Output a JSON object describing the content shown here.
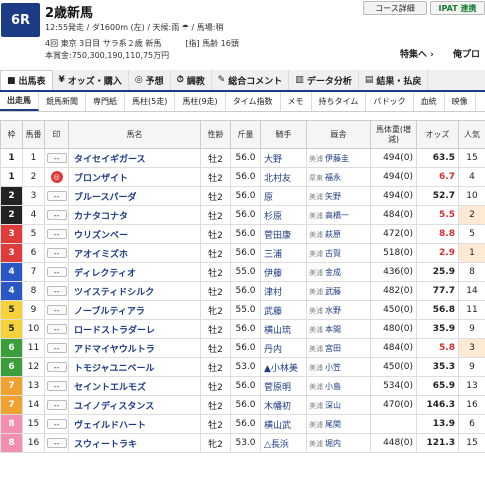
{
  "race": {
    "badge": "6R",
    "title": "2歳新馬",
    "info1": "12:55発走 / ダ1600m (左) / 天候:雨 ☂ / 馬場:稍",
    "info2": "4回 東京 3日目 サラ系２歳 新馬　　　[指] 馬齢 16頭",
    "info3": "本賞金:750,300,190,110,75万円"
  },
  "header_buttons": {
    "course": "コース詳細",
    "ipat": "IPAT 連携"
  },
  "links": {
    "tokusyu": "特集へ ›",
    "fav": "俺プロ"
  },
  "tabs": [
    {
      "label": "出馬表",
      "icon": "■"
    },
    {
      "label": "オッズ・購入",
      "icon": "¥"
    },
    {
      "label": "予想",
      "icon": "◎"
    },
    {
      "label": "調教",
      "icon": "⏱"
    },
    {
      "label": "総合コメント",
      "icon": "✎"
    },
    {
      "label": "データ分析",
      "icon": "▥"
    },
    {
      "label": "結果・払戻",
      "icon": "▤"
    }
  ],
  "subtabs": [
    "出走馬",
    "競馬新聞",
    "専門紙",
    "馬柱(5走)",
    "馬柱(9走)",
    "タイム指数",
    "メモ",
    "持ちタイム",
    "パドック",
    "血統",
    "映像"
  ],
  "columns": {
    "waku": "枠",
    "umaban": "馬番",
    "mark": "印",
    "horse": "馬名",
    "sexage": "性齢",
    "weight": "斤量",
    "jockey": "騎手",
    "trainer": "厩舎",
    "bodyweight": "馬体重(増減)",
    "odds": "オッズ",
    "pop": "人気"
  },
  "colors": {
    "waku1": "#ffffff",
    "waku2": "#222222",
    "waku3": "#e03b3b",
    "waku4": "#2a56c6",
    "waku5": "#f5d23a",
    "waku6": "#3a9e3a",
    "waku7": "#f0a230",
    "waku8": "#f28fb0",
    "accent": "#1c3b86",
    "oddsred": "#d32f2f"
  },
  "rows": [
    {
      "waku": "1",
      "umaban": "1",
      "mark": "--",
      "horse": "タイセイギガース",
      "sexage": "牡2",
      "weight": "56.0",
      "jockey": "大野",
      "region": "美浦",
      "trainer": "伊藤圭",
      "bw": "494(0)",
      "odds": "63.5",
      "pop": "15"
    },
    {
      "waku": "1",
      "umaban": "2",
      "mark": "◎",
      "horse": "ブロンザイト",
      "sexage": "牡2",
      "weight": "56.0",
      "jockey": "北村友",
      "region": "栗東",
      "trainer": "福永",
      "bw": "494(0)",
      "odds": "6.7",
      "pop": "4"
    },
    {
      "waku": "2",
      "umaban": "3",
      "mark": "--",
      "horse": "ブルースパーダ",
      "sexage": "牡2",
      "weight": "56.0",
      "jockey": "原",
      "region": "美浦",
      "trainer": "矢野",
      "bw": "494(0)",
      "odds": "52.7",
      "pop": "10"
    },
    {
      "waku": "2",
      "umaban": "4",
      "mark": "--",
      "horse": "カナタコナタ",
      "sexage": "牡2",
      "weight": "56.0",
      "jockey": "杉原",
      "region": "美浦",
      "trainer": "高橋一",
      "bw": "484(0)",
      "odds": "5.5",
      "pop": "2"
    },
    {
      "waku": "3",
      "umaban": "5",
      "mark": "--",
      "horse": "ウリズンベー",
      "sexage": "牡2",
      "weight": "56.0",
      "jockey": "菅田康",
      "region": "美浦",
      "trainer": "萩原",
      "bw": "472(0)",
      "odds": "8.8",
      "pop": "5"
    },
    {
      "waku": "3",
      "umaban": "6",
      "mark": "--",
      "horse": "アオイミズホ",
      "sexage": "牡2",
      "weight": "56.0",
      "jockey": "三浦",
      "region": "美浦",
      "trainer": "古賀",
      "bw": "518(0)",
      "odds": "2.9",
      "pop": "1"
    },
    {
      "waku": "4",
      "umaban": "7",
      "mark": "--",
      "horse": "ディレクティオ",
      "sexage": "牡2",
      "weight": "55.0",
      "jockey": "伊藤",
      "region": "美浦",
      "trainer": "金成",
      "bw": "436(0)",
      "odds": "25.9",
      "pop": "8"
    },
    {
      "waku": "4",
      "umaban": "8",
      "mark": "--",
      "horse": "ツイスティドシルク",
      "sexage": "牡2",
      "weight": "56.0",
      "jockey": "津村",
      "region": "美浦",
      "trainer": "武藤",
      "bw": "482(0)",
      "odds": "77.7",
      "pop": "14"
    },
    {
      "waku": "5",
      "umaban": "9",
      "mark": "--",
      "horse": "ノーブルティアラ",
      "sexage": "牝2",
      "weight": "55.0",
      "jockey": "武藤",
      "region": "美浦",
      "trainer": "水野",
      "bw": "450(0)",
      "odds": "56.8",
      "pop": "11"
    },
    {
      "waku": "5",
      "umaban": "10",
      "mark": "--",
      "horse": "ロードストラダーレ",
      "sexage": "牡2",
      "weight": "56.0",
      "jockey": "横山琉",
      "region": "美浦",
      "trainer": "本間",
      "bw": "480(0)",
      "odds": "35.9",
      "pop": "9"
    },
    {
      "waku": "6",
      "umaban": "11",
      "mark": "--",
      "horse": "アドマイヤウルトラ",
      "sexage": "牡2",
      "weight": "56.0",
      "jockey": "丹内",
      "region": "美浦",
      "trainer": "宮田",
      "bw": "484(0)",
      "odds": "5.8",
      "pop": "3"
    },
    {
      "waku": "6",
      "umaban": "12",
      "mark": "--",
      "horse": "トモジャユニベール",
      "sexage": "牡2",
      "weight": "53.0",
      "jockey": "▲小林美",
      "region": "美浦",
      "trainer": "小笠",
      "bw": "450(0)",
      "odds": "35.3",
      "pop": "9"
    },
    {
      "waku": "7",
      "umaban": "13",
      "mark": "--",
      "horse": "セイントエルモズ",
      "sexage": "牡2",
      "weight": "56.0",
      "jockey": "菅原明",
      "region": "美浦",
      "trainer": "小島",
      "bw": "534(0)",
      "odds": "65.9",
      "pop": "13"
    },
    {
      "waku": "7",
      "umaban": "14",
      "mark": "--",
      "horse": "ユイノディスタンス",
      "sexage": "牡2",
      "weight": "56.0",
      "jockey": "木幡初",
      "region": "美浦",
      "trainer": "深山",
      "bw": "470(0)",
      "odds": "146.3",
      "pop": "16"
    },
    {
      "waku": "8",
      "umaban": "15",
      "mark": "--",
      "horse": "ヴェイルドハート",
      "sexage": "牡2",
      "weight": "56.0",
      "jockey": "横山武",
      "region": "美浦",
      "trainer": "尾関",
      "bw": "",
      "odds": "13.9",
      "pop": "6"
    },
    {
      "waku": "8",
      "umaban": "16",
      "mark": "--",
      "horse": "スウィートラキ",
      "sexage": "牝2",
      "weight": "53.0",
      "jockey": "△長浜",
      "region": "美浦",
      "trainer": "堀内",
      "bw": "448(0)",
      "odds": "121.3",
      "pop": "15"
    }
  ]
}
